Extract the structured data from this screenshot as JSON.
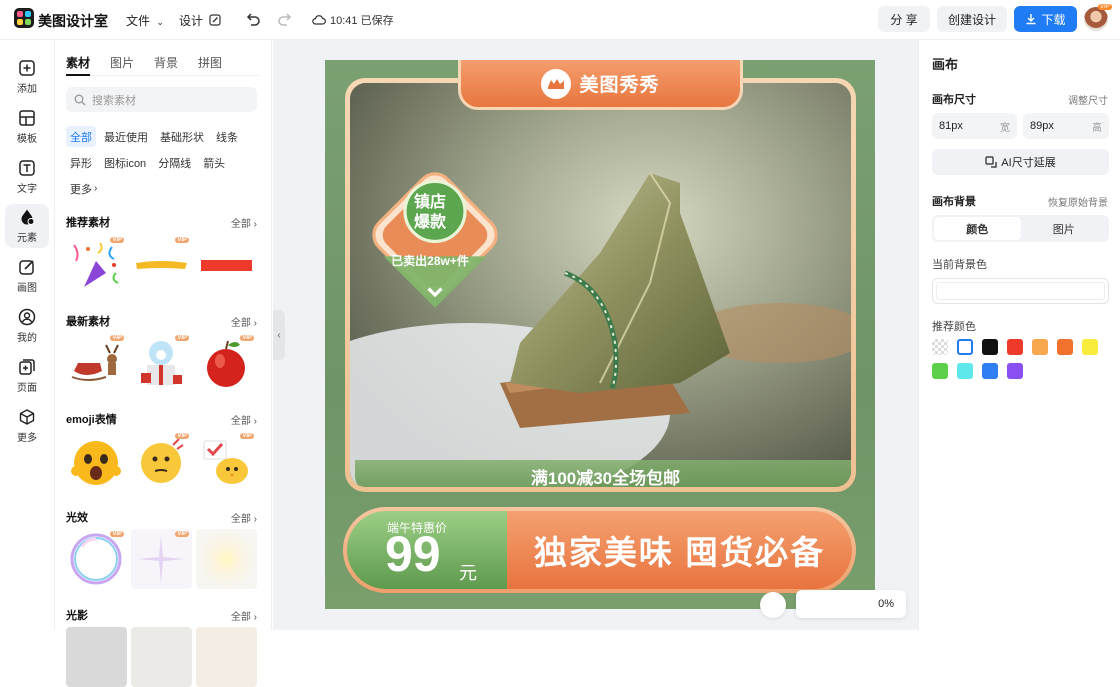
{
  "app": {
    "title": "美图设计室"
  },
  "topbar": {
    "file_menu": "文件",
    "design_menu": "设计",
    "saved_status": "10:41 已保存",
    "share_label": "分 享",
    "create_label": "创建设计",
    "download_label": "下载",
    "avatar_badge": "VIP"
  },
  "rail": {
    "items": [
      {
        "label": "添加",
        "icon": "plus-square-icon"
      },
      {
        "label": "模板",
        "icon": "template-icon"
      },
      {
        "label": "文字",
        "icon": "text-icon"
      },
      {
        "label": "元素",
        "icon": "shapes-icon"
      },
      {
        "label": "画图",
        "icon": "pen-icon"
      },
      {
        "label": "我的",
        "icon": "user-icon"
      },
      {
        "label": "页面",
        "icon": "page-icon"
      },
      {
        "label": "更多",
        "icon": "cube-icon"
      }
    ],
    "active_index": 3
  },
  "panel": {
    "tabs": [
      "素材",
      "图片",
      "背景",
      "拼图"
    ],
    "search_placeholder": "搜索素材",
    "chips": [
      "全部",
      "最近使用",
      "基础形状",
      "线条",
      "异形",
      "图标icon",
      "分隔线",
      "箭头",
      "更多"
    ],
    "all_label": "全部",
    "sections": [
      {
        "title": "推荐素材"
      },
      {
        "title": "最新素材"
      },
      {
        "title": "emoji表情"
      },
      {
        "title": "光效"
      },
      {
        "title": "光影"
      }
    ],
    "vip_tag": "VIP"
  },
  "canvas": {
    "brand_name": "美图秀秀",
    "badge_line1": "镇店",
    "badge_line2": "爆款",
    "badge_sold": "已卖出28w+件",
    "promo": "满100减30全场包邮",
    "price_label": "端午特惠价",
    "price_value": "99",
    "price_unit": "元",
    "slogan": "独家美味 囤货必备",
    "zoom_text": "0%"
  },
  "inspector": {
    "title": "画布",
    "size_label": "画布尺寸",
    "adjust_link": "调整尺寸",
    "width_value": "81px",
    "width_unit": "宽",
    "height_value": "89px",
    "height_unit": "高",
    "ai_button": "AI尺寸延展",
    "bg_label": "画布背景",
    "restore_link": "恢复原始背景",
    "seg_color": "颜色",
    "seg_image": "图片",
    "current_bg_label": "当前背景色",
    "recommend_label": "推荐颜色",
    "swatches": [
      "transparent",
      "#ffffff",
      "#111111",
      "#ee3a2b",
      "#f7a74e",
      "#f0722c",
      "#f8ec3d",
      "#5dd04b",
      "#5fe8ec",
      "#2f7ff2",
      "#8a4ff0"
    ]
  }
}
